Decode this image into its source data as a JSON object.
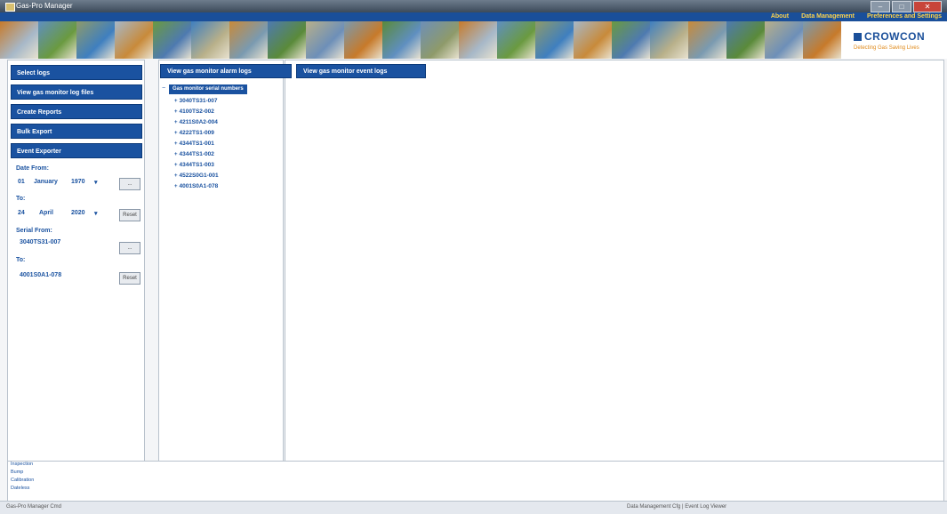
{
  "window": {
    "title": "Gas-Pro Manager"
  },
  "menu": {
    "items": [
      "About",
      "Data Management",
      "Preferences and Settings"
    ]
  },
  "banner": {
    "tile_colors": [
      "#c77a2a",
      "#5f8fc0",
      "#8e9a6a",
      "#a7b8c8",
      "#6a9a40",
      "#3f7fbf",
      "#c88a3a",
      "#4e7ab0",
      "#b8b08a",
      "#7a9ab0",
      "#5a8a3a",
      "#6d8fb8"
    ]
  },
  "logo": {
    "name": "CROWCON",
    "tagline_a": "Detecting Gas",
    "tagline_b": "Saving Lives"
  },
  "sidebar": {
    "buttons": [
      "Select logs",
      "View gas monitor log files",
      "Create Reports",
      "Bulk Export",
      "Event Exporter"
    ],
    "date_from_label": "Date From:",
    "date_from": {
      "day": "01",
      "month": "January",
      "year": "1970"
    },
    "date_to_label": "To:",
    "date_to": {
      "day": "24",
      "month": "April",
      "year": "2020"
    },
    "serial_from_label": "Serial From:",
    "serial_from": "3040TS31-007",
    "serial_to_label": "To:",
    "serial_to": "4001S0A1-078",
    "btn_small": "...",
    "btn_reset": "Reset"
  },
  "middle": {
    "header": "View gas monitor alarm logs",
    "root": "Gas monitor serial numbers",
    "items": [
      "3040TS31-007",
      "4100TS2-002",
      "4211S0A2-004",
      "4222TS1-009",
      "4344TS1-001",
      "4344TS1-002",
      "4344TS1-003",
      "4522S0G1-001",
      "4001S0A1-078"
    ]
  },
  "right": {
    "header": "View gas monitor event logs"
  },
  "status_list": [
    "Inspection",
    "Bump",
    "Calibration",
    "Dateless"
  ],
  "footer": {
    "left": "Gas-Pro Manager Cmd",
    "mid": "Data Management Cfg | Event Log Viewer"
  }
}
